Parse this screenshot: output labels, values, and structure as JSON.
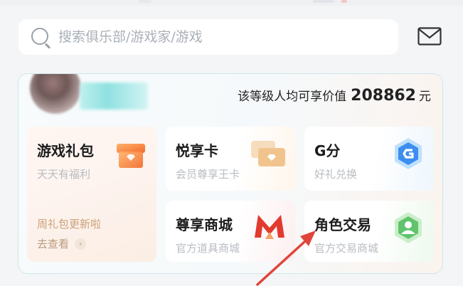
{
  "search": {
    "placeholder": "搜索俱乐部/游戏家/游戏"
  },
  "icons": {
    "search": "search-icon",
    "mail": "mail-icon",
    "gift": "gift-box-icon",
    "cards": "cards-icon",
    "g_points": "g-badge-icon",
    "shop": "m-logo-icon",
    "trade": "user-hexagon-icon",
    "chevron": "chevron-right-icon",
    "annotation_arrow": "red-arrow"
  },
  "profile": {
    "value_prefix": "该等级人均可享价值",
    "value_number": "208862",
    "value_unit": "元"
  },
  "tiles": [
    {
      "title": "游戏礼包",
      "subtitle": "天天有福利",
      "promo": "周礼包更新啦",
      "cta": "去查看",
      "cta_glyph": "›"
    },
    {
      "title": "悦享卡",
      "subtitle": "会员尊享王卡"
    },
    {
      "title": "G分",
      "subtitle": "好礼兑换"
    },
    {
      "title": "尊享商城",
      "subtitle": "官方道具商城"
    },
    {
      "title": "角色交易",
      "subtitle": "官方交易商城"
    }
  ],
  "colors": {
    "accent_red": "#e0453a",
    "gift_orange": "#f4823c",
    "card_orange": "#f1c48e",
    "g_blue": "#3c8ef0",
    "trade_green": "#62c46f",
    "card_border": "#cfe8ea"
  }
}
